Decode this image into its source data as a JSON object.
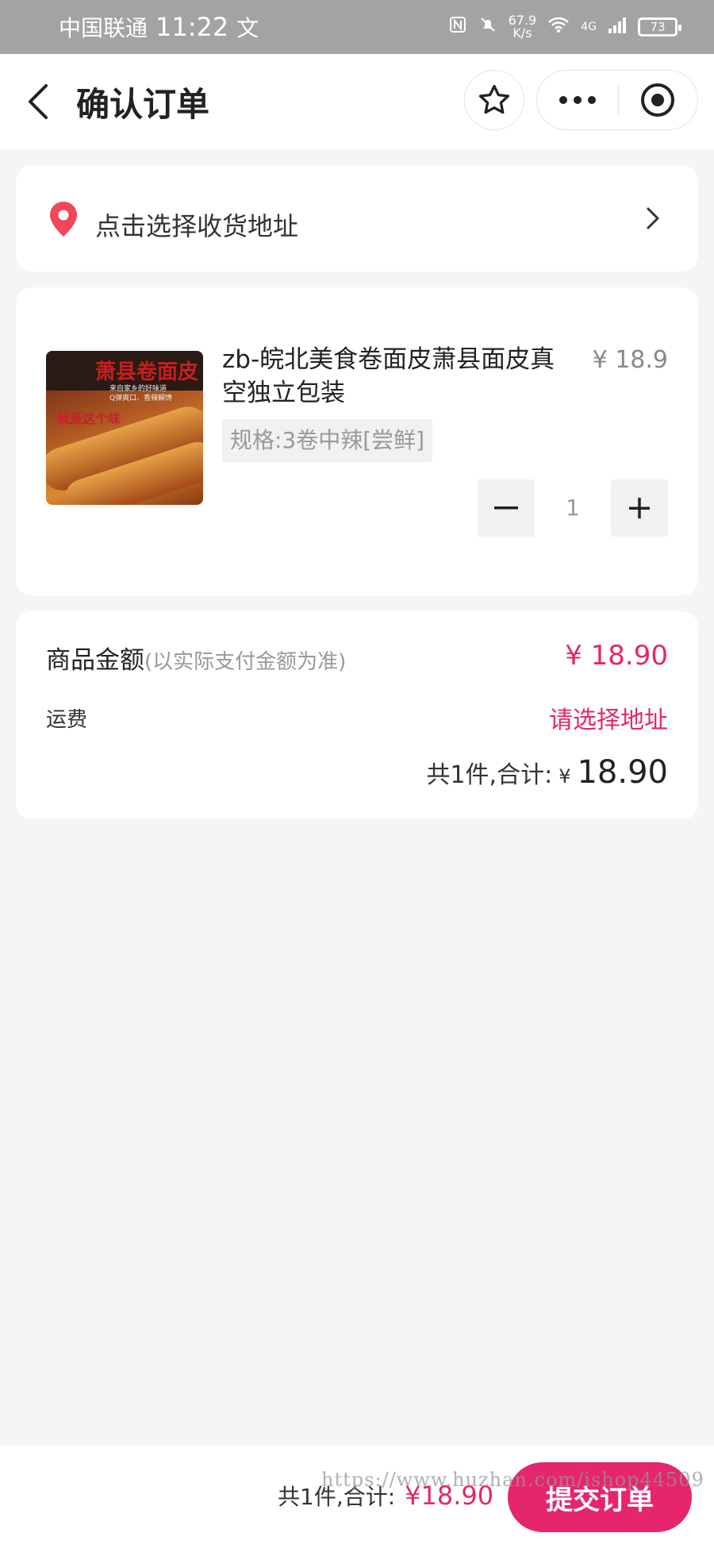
{
  "status_bar": {
    "carrier": "中国联通",
    "time": "11:22",
    "extra_icon": "文",
    "speed_value": "67.9",
    "speed_unit": "K/s",
    "network": "4G",
    "battery": "73"
  },
  "nav": {
    "title": "确认订单"
  },
  "address": {
    "label": "点击选择收货地址"
  },
  "product": {
    "title": "zb-皖北美食卷面皮萧县面皮真空独立包装",
    "price": "¥ 18.9",
    "spec": "规格:3卷中辣[尝鲜]",
    "quantity": "1",
    "image_banner": "萧县卷面皮",
    "image_sub1": "来自家乡的好味道",
    "image_sub2": "Q弹爽口、香辣解馋",
    "image_tag": "就是这个味"
  },
  "summary": {
    "goods_label": "商品金额",
    "goods_note": "(以实际支付金额为准)",
    "goods_amount": "¥ 18.90",
    "shipping_label": "运费",
    "shipping_value": "请选择地址",
    "subtotal_label": "共1件,合计:",
    "subtotal_currency": "¥",
    "subtotal_value": "18.90"
  },
  "bottom": {
    "total_label": "共1件,合计:",
    "total_value": "¥18.90",
    "submit_label": "提交订单"
  },
  "watermark": "https://www.huzhan.com/ishop44509",
  "colors": {
    "accent": "#e5266c",
    "status_bar": "#a3a3a3",
    "background": "#f5f5f5"
  },
  "icons": [
    "back-arrow-icon",
    "star-icon",
    "more-dots-icon",
    "close-circle-icon",
    "location-pin-icon",
    "chevron-right-icon",
    "minus-icon",
    "plus-icon"
  ]
}
